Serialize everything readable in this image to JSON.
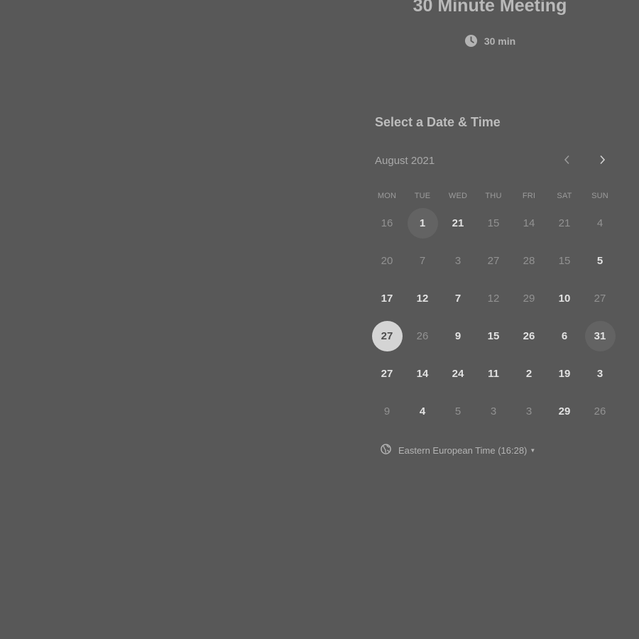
{
  "event": {
    "title": "30 Minute Meeting",
    "duration": "30 min",
    "duration_icon": "clock-icon"
  },
  "scheduler": {
    "heading": "Select a Date & Time",
    "month": "August 2021",
    "prev_icon": "chevron-left-icon",
    "next_icon": "chevron-right-icon"
  },
  "calendar": {
    "weekdays": [
      "MON",
      "TUE",
      "WED",
      "THU",
      "FRI",
      "SAT",
      "SUN"
    ],
    "weeks": [
      [
        {
          "label": "16",
          "available": false
        },
        {
          "label": "1",
          "available": true,
          "highlight": true
        },
        {
          "label": "21",
          "available": true
        },
        {
          "label": "15",
          "available": false
        },
        {
          "label": "14",
          "available": false
        },
        {
          "label": "21",
          "available": false
        },
        {
          "label": "4",
          "available": false
        }
      ],
      [
        {
          "label": "20",
          "available": false
        },
        {
          "label": "7",
          "available": false
        },
        {
          "label": "3",
          "available": false
        },
        {
          "label": "27",
          "available": false
        },
        {
          "label": "28",
          "available": false
        },
        {
          "label": "15",
          "available": false
        },
        {
          "label": "5",
          "available": true
        }
      ],
      [
        {
          "label": "17",
          "available": true
        },
        {
          "label": "12",
          "available": true
        },
        {
          "label": "7",
          "available": true
        },
        {
          "label": "12",
          "available": false
        },
        {
          "label": "29",
          "available": false
        },
        {
          "label": "10",
          "available": true
        },
        {
          "label": "27",
          "available": false
        }
      ],
      [
        {
          "label": "27",
          "available": true,
          "selected": true
        },
        {
          "label": "26",
          "available": false
        },
        {
          "label": "9",
          "available": true
        },
        {
          "label": "15",
          "available": true
        },
        {
          "label": "26",
          "available": true
        },
        {
          "label": "6",
          "available": true
        },
        {
          "label": "31",
          "available": true,
          "highlight": true
        }
      ],
      [
        {
          "label": "27",
          "available": true
        },
        {
          "label": "14",
          "available": true
        },
        {
          "label": "24",
          "available": true
        },
        {
          "label": "11",
          "available": true
        },
        {
          "label": "2",
          "available": true
        },
        {
          "label": "19",
          "available": true
        },
        {
          "label": "3",
          "available": true
        }
      ],
      [
        {
          "label": "9",
          "available": false
        },
        {
          "label": "4",
          "available": true
        },
        {
          "label": "5",
          "available": false
        },
        {
          "label": "3",
          "available": false
        },
        {
          "label": "3",
          "available": false
        },
        {
          "label": "29",
          "available": true
        },
        {
          "label": "26",
          "available": false
        }
      ]
    ]
  },
  "timezone": {
    "label": "Eastern European Time (16:28)",
    "icon": "globe-icon",
    "dropdown_icon": "caret-down-icon"
  },
  "colors": {
    "background": "#585858",
    "selected_day_bg": "#d4d4d4",
    "highlight_day_bg": "#636363"
  }
}
